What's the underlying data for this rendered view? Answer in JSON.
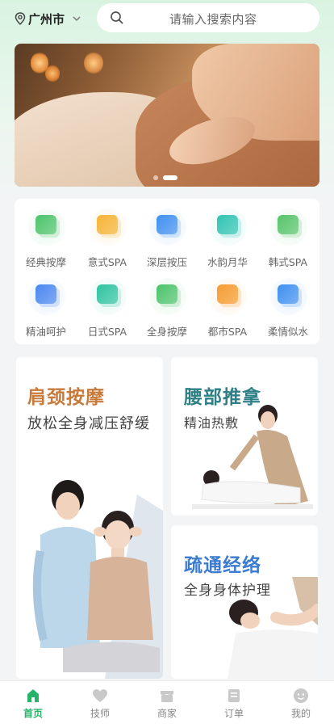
{
  "header": {
    "city": "广州市",
    "search_placeholder": "请输入搜索内容"
  },
  "banner": {
    "slide_count": 2,
    "active_index": 1
  },
  "categories": [
    {
      "label": "经典按摩",
      "icon": "leaf-card-icon",
      "color": "#4cc36a"
    },
    {
      "label": "意式SPA",
      "icon": "cart-icon",
      "color": "#f5b335"
    },
    {
      "label": "深层按压",
      "icon": "bag-icon",
      "color": "#3f8ff0"
    },
    {
      "label": "水韵月华",
      "icon": "basket-icon",
      "color": "#2fc3b3"
    },
    {
      "label": "韩式SPA",
      "icon": "note-icon",
      "color": "#56c46a"
    },
    {
      "label": "精油呵护",
      "icon": "card-icon",
      "color": "#4a86f0"
    },
    {
      "label": "日式SPA",
      "icon": "chart-icon",
      "color": "#2fc3a0"
    },
    {
      "label": "全身按摩",
      "icon": "arrow-circle-icon",
      "color": "#4cc36a"
    },
    {
      "label": "都市SPA",
      "icon": "coin-icon",
      "color": "#f59b2f"
    },
    {
      "label": "柔情似水",
      "icon": "hash-icon",
      "color": "#3f8ff0"
    }
  ],
  "promos": [
    {
      "title": "肩颈按摩",
      "subtitle": "放松全身减压舒缓",
      "title_color": "#c77a3a"
    },
    {
      "title": "腰部推拿",
      "subtitle": "精油热敷",
      "title_color": "#2f7f86"
    },
    {
      "title": "疏通经络",
      "subtitle": "全身身体护理",
      "title_color": "#3b7bd0"
    }
  ],
  "nav": [
    {
      "label": "首页",
      "icon": "home-icon",
      "active": true
    },
    {
      "label": "技师",
      "icon": "heart-icon",
      "active": false
    },
    {
      "label": "商家",
      "icon": "shop-icon",
      "active": false
    },
    {
      "label": "订单",
      "icon": "order-icon",
      "active": false
    },
    {
      "label": "我的",
      "icon": "profile-icon",
      "active": false
    }
  ],
  "colors": {
    "accent": "#27b36a",
    "nav_inactive": "#888888"
  }
}
